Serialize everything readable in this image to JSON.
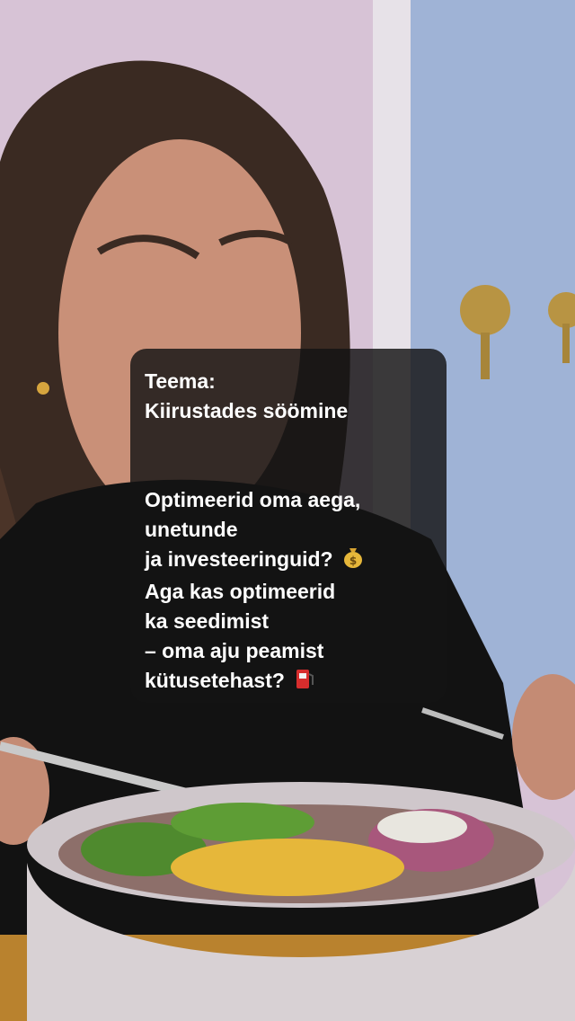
{
  "caption": {
    "lines": [
      "Teema:",
      "Kiirustades söömine",
      "",
      "",
      "Optimeerid oma aega,",
      "unetunde",
      "ja investeeringuid?",
      "Aga kas optimeerid",
      "ka seedimist",
      "– oma aju peamist",
      "kütusetehast?"
    ],
    "emoji_money": "money-bag",
    "emoji_fuel": "fuel-pump"
  },
  "colors": {
    "wall_left": "#d7c3d6",
    "wall_right": "#9fb3d6",
    "caption_bg": "#141414",
    "food_yellow": "#e6b73a",
    "greens": "#4f8a2e",
    "bowl": "#d8d1d4"
  }
}
